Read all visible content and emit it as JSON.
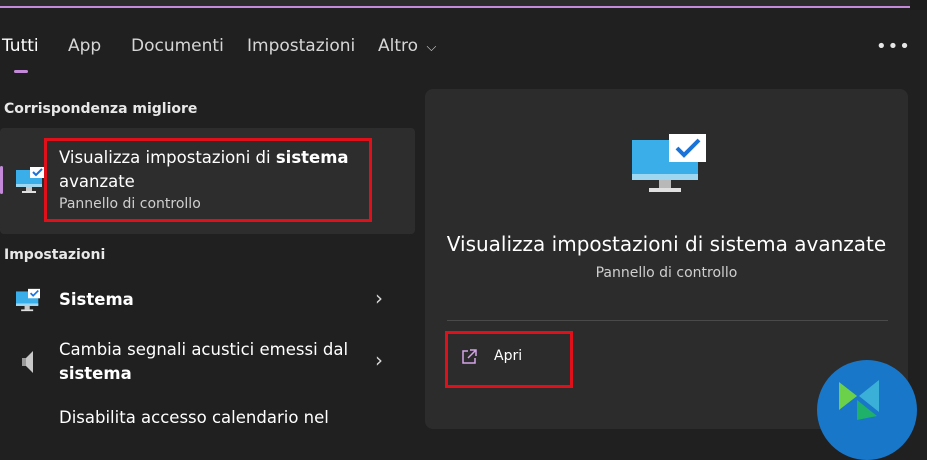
{
  "tabs": {
    "all": "Tutti",
    "apps": "App",
    "documents": "Documenti",
    "settings": "Impostazioni",
    "more": "Altro",
    "more_chevron": "⌵",
    "overflow": "•••"
  },
  "best_match": {
    "heading": "Corrispondenza migliore",
    "title_part1": "Visualizza impostazioni di ",
    "title_bold": "sistema",
    "title_part2": "avanzate",
    "subtitle": "Pannello di controllo",
    "icon": "monitor-check-icon"
  },
  "settings_section": {
    "heading": "Impostazioni",
    "items": [
      {
        "label": "Sistema",
        "icon": "monitor-check-icon"
      },
      {
        "label_part1": "Cambia segnali acustici emessi dal",
        "label_bold": "sistema",
        "icon": "speaker-icon"
      },
      {
        "label": "Disabilita accesso calendario nel"
      }
    ]
  },
  "detail_panel": {
    "title": "Visualizza impostazioni di sistema avanzate",
    "subtitle": "Pannello di controllo",
    "open_label": "Apri",
    "open_icon": "external-link-icon"
  },
  "colors": {
    "accent": "#c48ad9",
    "highlight_box": "#e0101a",
    "background": "#202020"
  }
}
